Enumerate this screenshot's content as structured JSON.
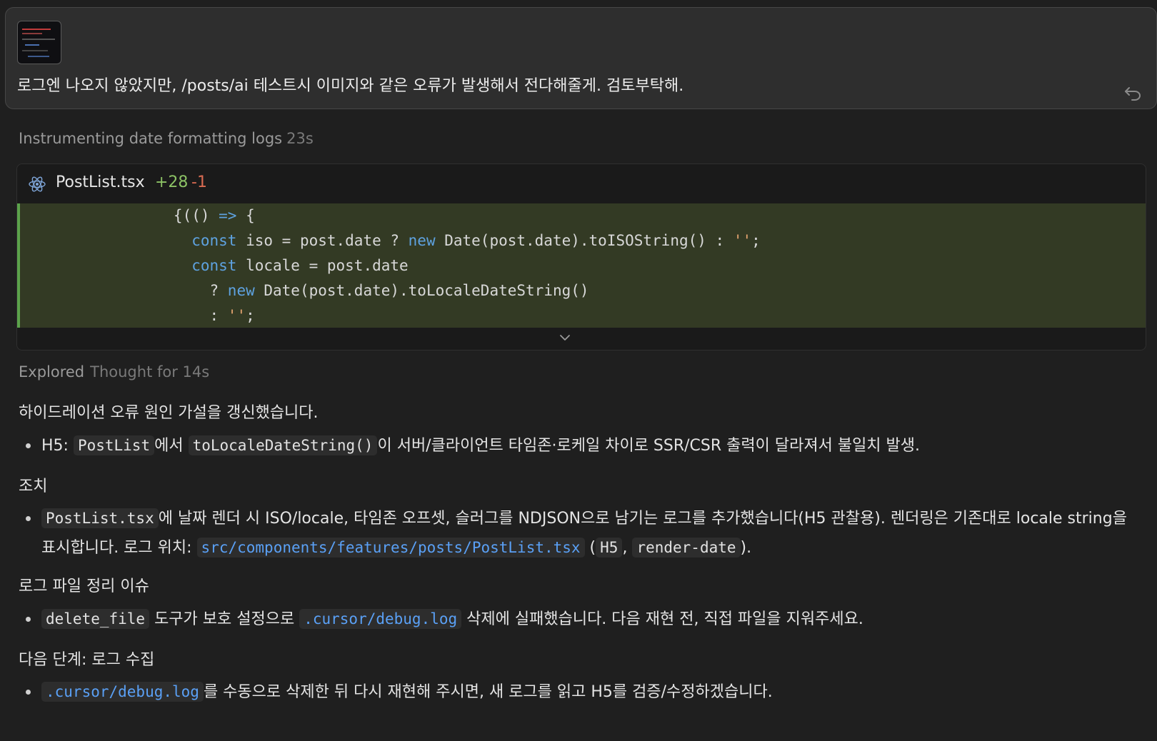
{
  "user_message": {
    "text": "로그엔 나오지 않았지만, /posts/ai 테스트시 이미지와 같은 오류가 발생해서 전다해줄게. 검토부탁해.",
    "attachment_icon": "image-thumbnail",
    "undo_icon": "undo-arrow-icon"
  },
  "step": {
    "title": "Instrumenting date formatting logs",
    "duration": "23s"
  },
  "diff": {
    "file_icon": "react-icon",
    "file_name": "PostList.tsx",
    "additions": "+28",
    "deletions": "-1",
    "lines": [
      [
        {
          "t": "                 {(() ",
          "c": ""
        },
        {
          "t": "=>",
          "c": "kw"
        },
        {
          "t": " {",
          "c": ""
        }
      ],
      [
        {
          "t": "                   ",
          "c": ""
        },
        {
          "t": "const",
          "c": "kw"
        },
        {
          "t": " iso = post.date ? ",
          "c": ""
        },
        {
          "t": "new",
          "c": "kw"
        },
        {
          "t": " Date(post.date).toISOString() : ",
          "c": ""
        },
        {
          "t": "''",
          "c": "str"
        },
        {
          "t": ";",
          "c": ""
        }
      ],
      [
        {
          "t": "                   ",
          "c": ""
        },
        {
          "t": "const",
          "c": "kw"
        },
        {
          "t": " locale = post.date",
          "c": ""
        }
      ],
      [
        {
          "t": "                     ? ",
          "c": ""
        },
        {
          "t": "new",
          "c": "kw"
        },
        {
          "t": " Date(post.date).toLocaleDateString()",
          "c": ""
        }
      ],
      [
        {
          "t": "                     : ",
          "c": ""
        },
        {
          "t": "''",
          "c": "str"
        },
        {
          "t": ";",
          "c": ""
        }
      ]
    ],
    "expand_icon": "chevron-down-icon",
    "colors": {
      "added_bg": "#333a24",
      "added_border": "#5ca34b",
      "keyword": "#5ea2e0",
      "string": "#e3a36f",
      "add_count": "#8cc265",
      "del_count": "#d96b52"
    }
  },
  "response": {
    "explored": "Explored",
    "thought": "Thought for 14s",
    "p1": "하이드레이션 오류 원인 가설을 갱신했습니다.",
    "b1": [
      {
        "t": "H5: "
      },
      {
        "code": "PostList"
      },
      {
        "t": "에서 "
      },
      {
        "code": "toLocaleDateString()"
      },
      {
        "t": "이 서버/클라이언트 타임존·로케일 차이로 SSR/CSR 출력이 달라져서 불일치 발생."
      }
    ],
    "h_action": "조치",
    "b2": [
      {
        "code": "PostList.tsx"
      },
      {
        "t": "에 날짜 렌더 시 ISO/locale, 타임존 오프셋, 슬러그를 NDJSON으로 남기는 로그를 추가했습니다(H5 관찰용). 렌더링은 기존대로 locale string을 표시합니다. 로그 위치: "
      },
      {
        "link": "src/components/features/posts/PostList.tsx"
      },
      {
        "t": " ("
      },
      {
        "code": "H5"
      },
      {
        "t": ", "
      },
      {
        "code": "render-date"
      },
      {
        "t": ")."
      }
    ],
    "h_log": "로그 파일 정리 이슈",
    "b3": [
      {
        "code": "delete_file"
      },
      {
        "t": " 도구가 보호 설정으로 "
      },
      {
        "link": ".cursor/debug.log"
      },
      {
        "t": " 삭제에 실패했습니다. 다음 재현 전, 직접 파일을 지워주세요."
      }
    ],
    "h_next": "다음 단계: 로그 수집",
    "b4": [
      {
        "link": ".cursor/debug.log"
      },
      {
        "t": "를 수동으로 삭제한 뒤 다시 재현해 주시면, 새 로그를 읽고 H5를 검증/수정하겠습니다."
      }
    ]
  }
}
